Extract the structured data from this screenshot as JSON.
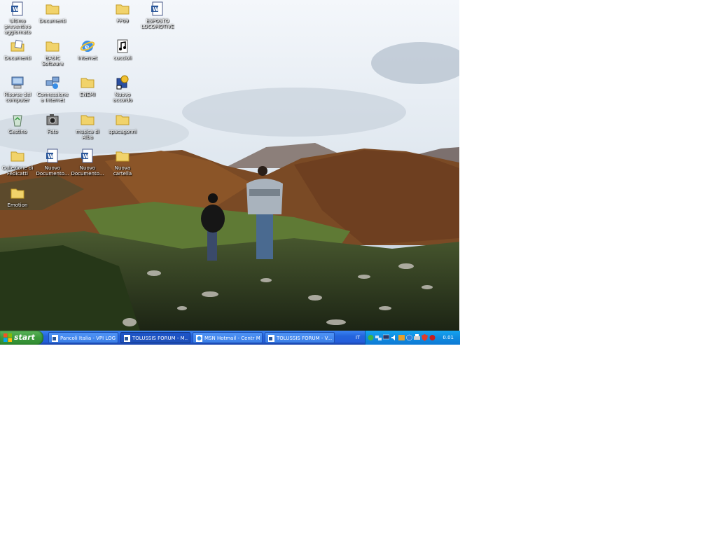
{
  "desktop": {
    "icons": [
      {
        "label": "Ultimo preventivo aggiornato",
        "type": "word-doc"
      },
      {
        "label": "Documenti",
        "type": "folder"
      },
      {
        "label": "FF09",
        "type": "folder"
      },
      {
        "label": "ESPOSTO LOCOMOTIVE",
        "type": "word-doc"
      },
      {
        "label": "Documenti",
        "type": "docs-folder"
      },
      {
        "label": "BASIC Software",
        "type": "folder"
      },
      {
        "label": "Internet",
        "type": "internet"
      },
      {
        "label": "cuccioli",
        "type": "media"
      },
      {
        "label": "Risorse del computer",
        "type": "computer"
      },
      {
        "label": "Connessione a Internet",
        "type": "network"
      },
      {
        "label": "ENEMI",
        "type": "folder"
      },
      {
        "label": "Nuovo accordo",
        "type": "shortcut"
      },
      {
        "label": "Cestino",
        "type": "recycle-bin"
      },
      {
        "label": "Foto",
        "type": "camera"
      },
      {
        "label": "musica di Alba",
        "type": "folder"
      },
      {
        "label": "spacagonni",
        "type": "folder"
      },
      {
        "label": "Collezione di Fedicatti",
        "type": "folder"
      },
      {
        "label": "Nuovo Documento...",
        "type": "word-doc"
      },
      {
        "label": "Nuovo Documento...",
        "type": "word-doc"
      },
      {
        "label": "Nuova cartella",
        "type": "folder"
      },
      {
        "label": "Emotion",
        "type": "folder"
      }
    ]
  },
  "taskbar": {
    "start_label": "start",
    "tasks": [
      {
        "label": "Pancoli Italia - VPI LOG...",
        "active": false
      },
      {
        "label": "TOLUSSIS FORUM - M...",
        "active": true
      },
      {
        "label": "MSN Hotmail - Centr M...",
        "active": false
      },
      {
        "label": "TOLUSSIS FORUM - V...",
        "active": false
      }
    ],
    "language": "IT",
    "tray_icons": [
      "messenger-icon",
      "network-icon",
      "monitor-icon",
      "speaker-icon",
      "antivirus-icon",
      "update-icon",
      "printer-icon",
      "security-icon",
      "alert-icon"
    ],
    "clock": "0.01"
  },
  "colors": {
    "taskbar_blue": "#245edb",
    "start_green": "#3c9a3c",
    "tray_blue": "#0f8be0"
  }
}
